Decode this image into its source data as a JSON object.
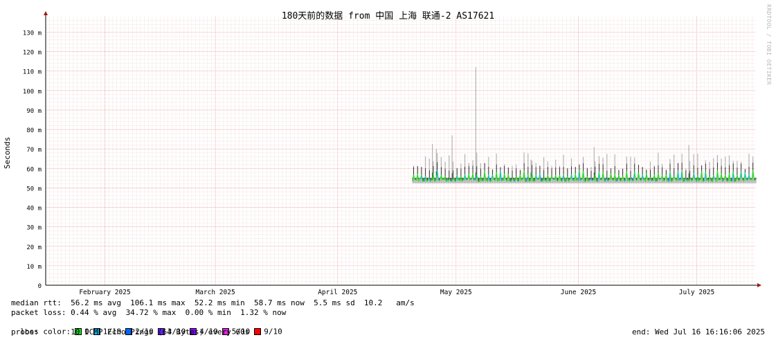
{
  "header": {
    "title": "180天前的数据 from 中国 上海 联通-2 AS17621",
    "watermark": "RRDTOOL / TOBI OETIKER",
    "ylabel": "Seconds"
  },
  "chart_data": {
    "type": "line",
    "title": "180天前的数据 from 中国 上海 联通-2 AS17621",
    "ylabel": "Seconds",
    "xlabel": "",
    "x_ticks": [
      "February 2025",
      "March 2025",
      "April 2025",
      "May 2025",
      "June 2025",
      "July 2025"
    ],
    "x_tick_dates": [
      "2025-02-01",
      "2025-03-01",
      "2025-04-01",
      "2025-05-01",
      "2025-06-01",
      "2025-07-01"
    ],
    "x_range": [
      "2025-01-17",
      "2025-07-16"
    ],
    "y_ticks": [
      "0",
      "10 m",
      "20 m",
      "30 m",
      "40 m",
      "50 m",
      "60 m",
      "70 m",
      "80 m",
      "90 m",
      "100 m",
      "110 m",
      "120 m",
      "130 m"
    ],
    "ylim": [
      0,
      0.138
    ],
    "grid": true,
    "data_start": "2025-04-20",
    "data_end": "2025-07-16",
    "median_baseline_s": 0.0532,
    "spikes": [
      {
        "date": "2025-04-25",
        "value_s": 0.0725
      },
      {
        "date": "2025-04-26",
        "value_s": 0.07
      },
      {
        "date": "2025-04-30",
        "value_s": 0.077
      },
      {
        "date": "2025-05-06",
        "value_s": 0.112
      },
      {
        "date": "2025-05-06",
        "value_s": 0.106
      },
      {
        "date": "2025-05-20",
        "value_s": 0.0645
      },
      {
        "date": "2025-06-05",
        "value_s": 0.071
      },
      {
        "date": "2025-06-29",
        "value_s": 0.072
      }
    ],
    "loss_colors": {
      "0": "#22dd22",
      "1/10": "#00bbff",
      "2/10": "#0066ff",
      "3/10": "#6622ff",
      "4/10": "#8800ff",
      "5/10": "#dd22dd",
      "9/10": "#ff0000"
    }
  },
  "legend": {
    "median_rtt": "median rtt:  56.2 ms avg  106.1 ms max  52.2 ms min  58.7 ms now  5.5 ms sd  10.2   am/s",
    "packet_loss": "packet loss: 0.44 % avg  34.72 % max  0.00 % min  1.32 % now",
    "loss_color_label": "loss color:",
    "loss_items": [
      {
        "label": "0",
        "color": "#22dd22"
      },
      {
        "label": "1/10",
        "color": "#00bbff"
      },
      {
        "label": "2/10",
        "color": "#0066ff"
      },
      {
        "label": "3/10",
        "color": "#6622ff"
      },
      {
        "label": "4/10",
        "color": "#8800ff"
      },
      {
        "label": "5/10",
        "color": "#dd22dd"
      },
      {
        "label": "9/10",
        "color": "#ff0000"
      }
    ],
    "probe": "probe:       10 ICMP Echo Pings (64 Bytes) every 60s",
    "end": "end: Wed Jul 16 16:16:06 2025"
  }
}
